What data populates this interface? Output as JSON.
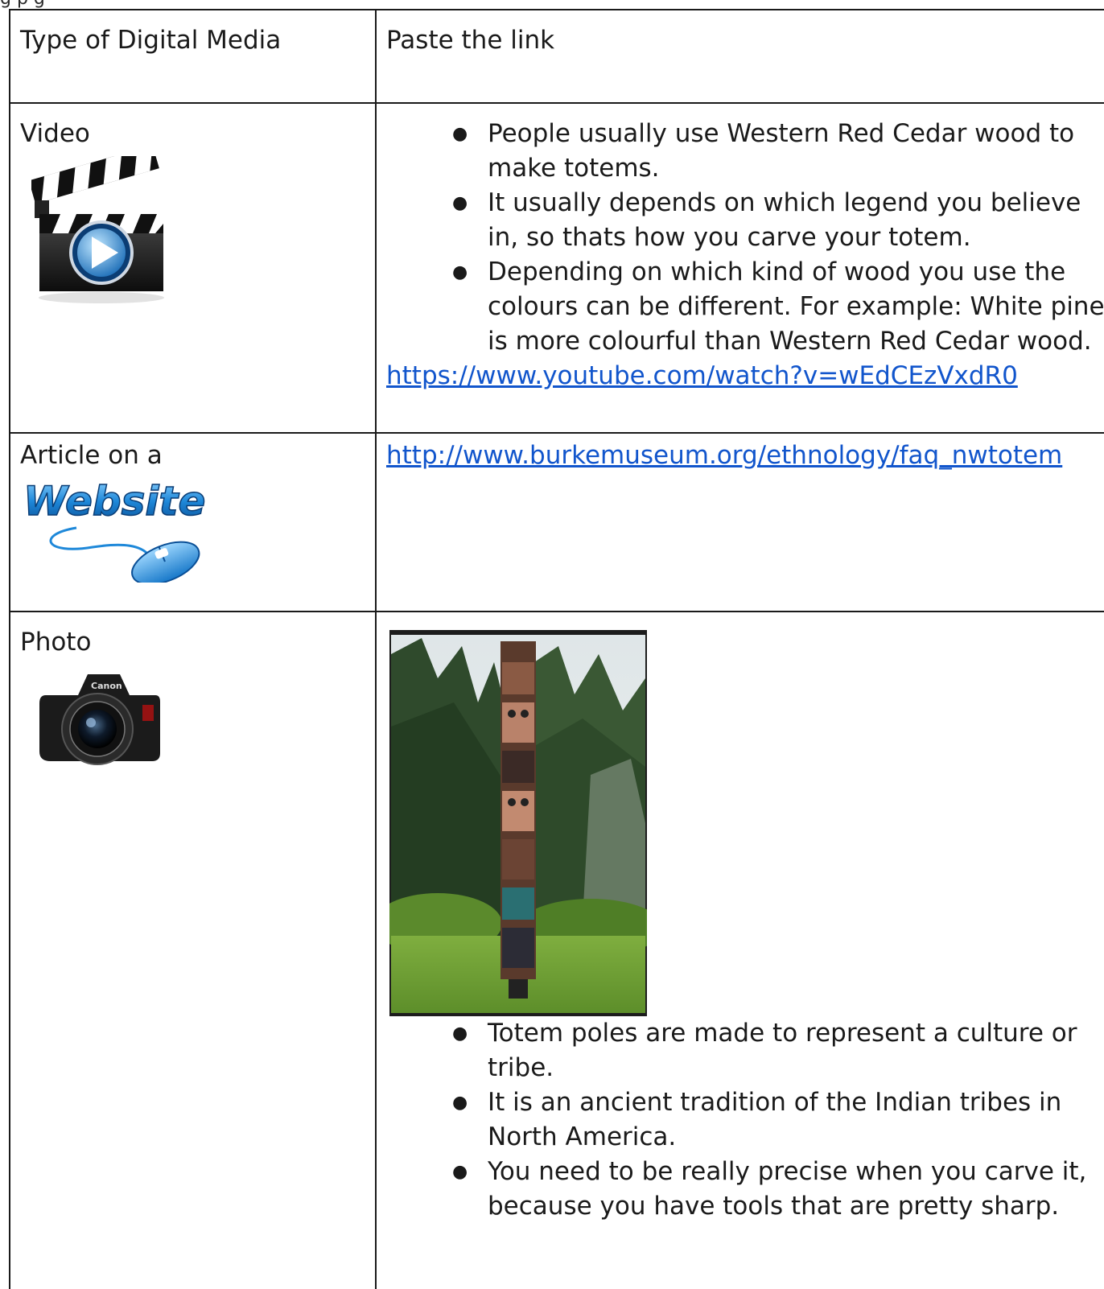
{
  "table": {
    "header": {
      "col1": "Type of Digital Media",
      "col2": "Paste the link"
    },
    "rows": {
      "video": {
        "label": "Video",
        "icon": "video-clapperboard-icon",
        "bullets": [
          "People usually use Western Red Cedar wood to make totems.",
          "It usually depends on which legend you believe in, so thats how you carve your totem.",
          "Depending on which kind of wood you use the colours can be different. For example: White pine is more colourful than Western Red Cedar wood."
        ],
        "link": "https://www.youtube.com/watch?v=wEdCEzVxdR0"
      },
      "article": {
        "label": "Article on a",
        "icon_text": "Website",
        "icon": "website-mouse-icon",
        "link": "http://www.burkemuseum.org/ethnology/faq_nwtotem"
      },
      "photo": {
        "label": "Photo",
        "icon": "camera-icon",
        "camera_brand": "Canon",
        "image": "totem-pole-photo",
        "bullets": [
          "Totem poles are made to represent a culture or tribe.",
          "It is an ancient tradition of the Indian tribes in North America.",
          "You need to be really precise when you carve it, because you have tools that are pretty sharp."
        ]
      }
    }
  },
  "colors": {
    "link": "#1155cc",
    "border": "#1a1a1a",
    "icon_blue": "#1e88d9"
  }
}
